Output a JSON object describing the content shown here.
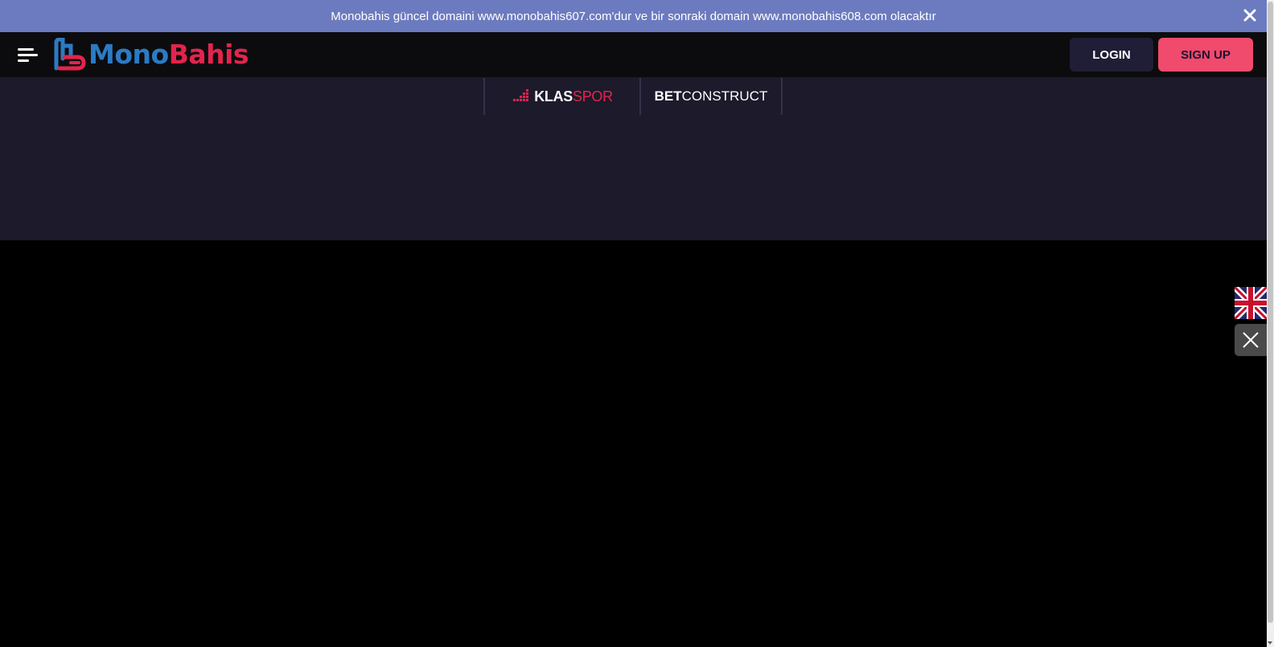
{
  "announcement": {
    "text": "Monobahis güncel domaini www.monobahis607.com'dur ve bir sonraki domain www.monobahis608.com olacaktır",
    "close_icon": "close-icon"
  },
  "header": {
    "menu_icon": "hamburger-menu-icon",
    "logo": {
      "part1": "Mono",
      "part2": "Bahis"
    },
    "login_label": "LOGIN",
    "signup_label": "SIGN UP"
  },
  "providers": [
    {
      "part1": "KLAS",
      "part2": "SPOR"
    },
    {
      "part1": "BET",
      "part2": "CONSTRUCT"
    }
  ],
  "language_widget": {
    "flag_icon": "uk-flag-icon",
    "close_icon": "close-icon"
  },
  "colors": {
    "announcement_bg": "#6c7bbf",
    "header_bg": "#0c0c0e",
    "band_bg": "#1c1a2b",
    "login_bg": "#201d36",
    "signup_bg": "#f04a6c",
    "brand_blue": "#2b7bc4",
    "brand_red": "#e3244d"
  }
}
